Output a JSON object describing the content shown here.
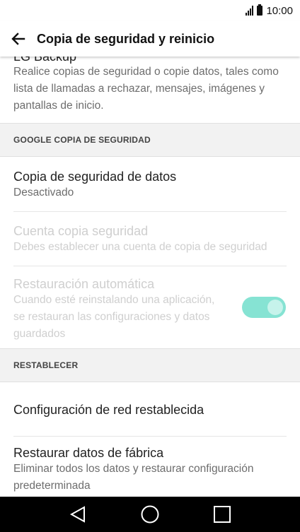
{
  "status_bar": {
    "time": "10:00"
  },
  "app_bar": {
    "title": "Copia de seguridad y reinicio"
  },
  "lg_backup": {
    "title": "LG Backup",
    "description": "Realice copias de seguridad o copie datos, tales como lista de llamadas a rechazar, mensajes, imágenes y pantallas de inicio."
  },
  "section_google": {
    "label": "GOOGLE COPIA DE SEGURIDAD"
  },
  "backup_data": {
    "title": "Copia de seguridad de datos",
    "subtitle": "Desactivado"
  },
  "backup_account": {
    "title": "Cuenta copia seguridad",
    "subtitle": "Debes establecer una cuenta de copia de seguridad"
  },
  "auto_restore": {
    "title": "Restauración automática",
    "subtitle": "Cuando esté reinstalando una aplicación, se restauran las configuraciones y datos guardados",
    "toggle_on": true
  },
  "section_reset": {
    "label": "RESTABLECER"
  },
  "network_reset": {
    "title": "Configuración de red restablecida"
  },
  "factory_reset": {
    "title": "Restaurar datos de fábrica",
    "subtitle": "Eliminar todos los datos y restaurar configuración predeterminada"
  },
  "colors": {
    "accent": "#86e3d3",
    "section_bg": "#f2f2f2"
  },
  "icons": {
    "back": "arrow-left-icon",
    "nav_back": "triangle-back-icon",
    "nav_home": "circle-home-icon",
    "nav_recents": "square-recents-icon"
  }
}
